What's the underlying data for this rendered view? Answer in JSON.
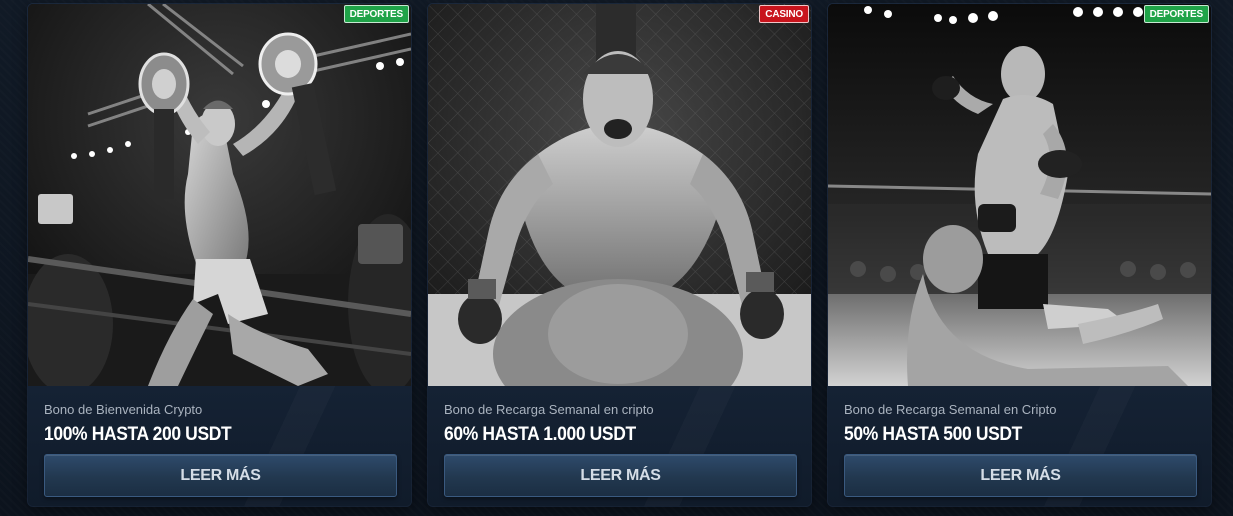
{
  "cards": [
    {
      "badge": "DEPORTES",
      "badge_color": "#1fa348",
      "image": "fighter-holding-championship-belts",
      "subtitle": "Bono de Bienvenida Crypto",
      "headline": "100% HASTA 200 USDT",
      "button_label": "LEER MÁS"
    },
    {
      "badge": "CASINO",
      "badge_color": "#c8141c",
      "image": "fighter-screaming-in-cage",
      "subtitle": "Bono de Recarga Semanal en cripto",
      "headline": "60% HASTA 1.000 USDT",
      "button_label": "LEER MÁS"
    },
    {
      "badge": "DEPORTES",
      "badge_color": "#1fa348",
      "image": "fighter-knockdown-in-octagon",
      "subtitle": "Bono de Recarga Semanal en Cripto",
      "headline": "50% HASTA 500 USDT",
      "button_label": "LEER MÁS"
    }
  ]
}
